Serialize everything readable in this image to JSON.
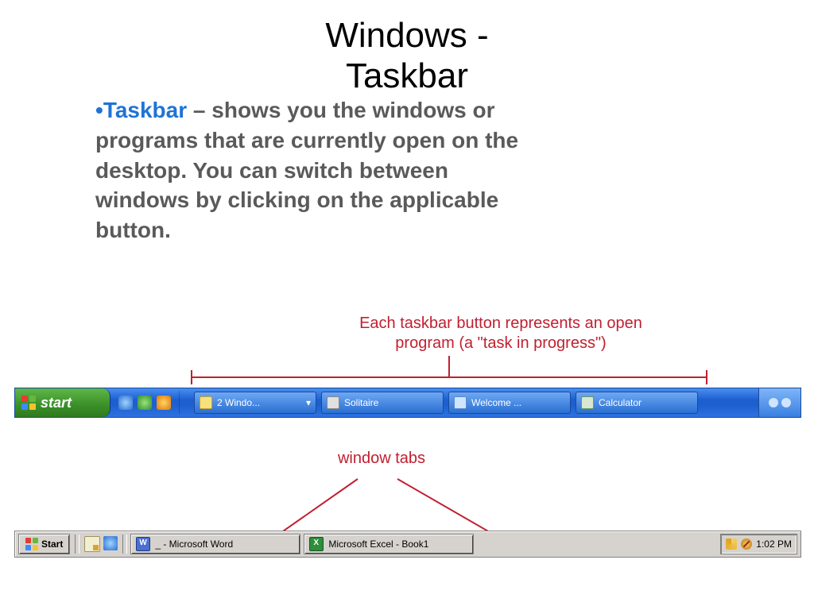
{
  "title_line1": "Windows -",
  "title_line2": "Taskbar",
  "bullet_char": "•",
  "term": "Taskbar",
  "definition_rest": " – shows you the windows or programs that are currently open on the desktop. You can switch between windows by clicking on the applicable button.",
  "callout1_line1": "Each taskbar button represents an open",
  "callout1_line2": "program (a \"task in progress\")",
  "callout2": "window tabs",
  "xp": {
    "start": "start",
    "tasks": [
      {
        "label": "2 Windo..."
      },
      {
        "label": "Solitaire"
      },
      {
        "label": "Welcome ..."
      },
      {
        "label": "Calculator"
      }
    ]
  },
  "classic": {
    "start": "Start",
    "tasks": [
      {
        "label": "_ - Microsoft Word"
      },
      {
        "label": "Microsoft Excel - Book1"
      }
    ],
    "clock": "1:02 PM"
  }
}
